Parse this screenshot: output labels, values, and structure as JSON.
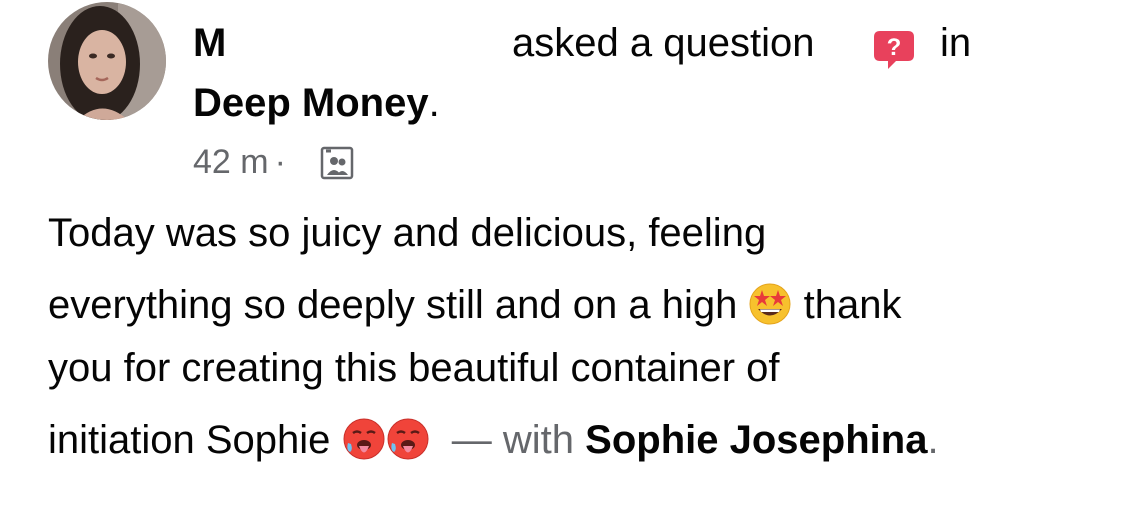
{
  "header": {
    "author_name": "M",
    "action_text": "asked a question",
    "question_badge_icon": "question-badge-icon",
    "question_badge_color": "#e8415c",
    "in_text": "in",
    "group_name": "Deep Money",
    "group_suffix": "."
  },
  "meta": {
    "timestamp": "42 m",
    "separator": "·",
    "audience_icon": "group-privacy-icon"
  },
  "post": {
    "line1": "Today was so juicy and delicious, feeling",
    "line2_before": "everything so deeply still and on a high",
    "line2_emoji": "star-struck-emoji",
    "line2_after": "thank",
    "line3": "you for creating this beautiful container of",
    "line4_before": "initiation Sophie",
    "line4_emojis": [
      "hot-face-emoji",
      "hot-face-emoji"
    ],
    "with_text": "— with",
    "tagged_name": "Sophie Josephina",
    "tagged_suffix": "."
  },
  "colors": {
    "text_primary": "#050505",
    "text_secondary": "#65676b"
  }
}
